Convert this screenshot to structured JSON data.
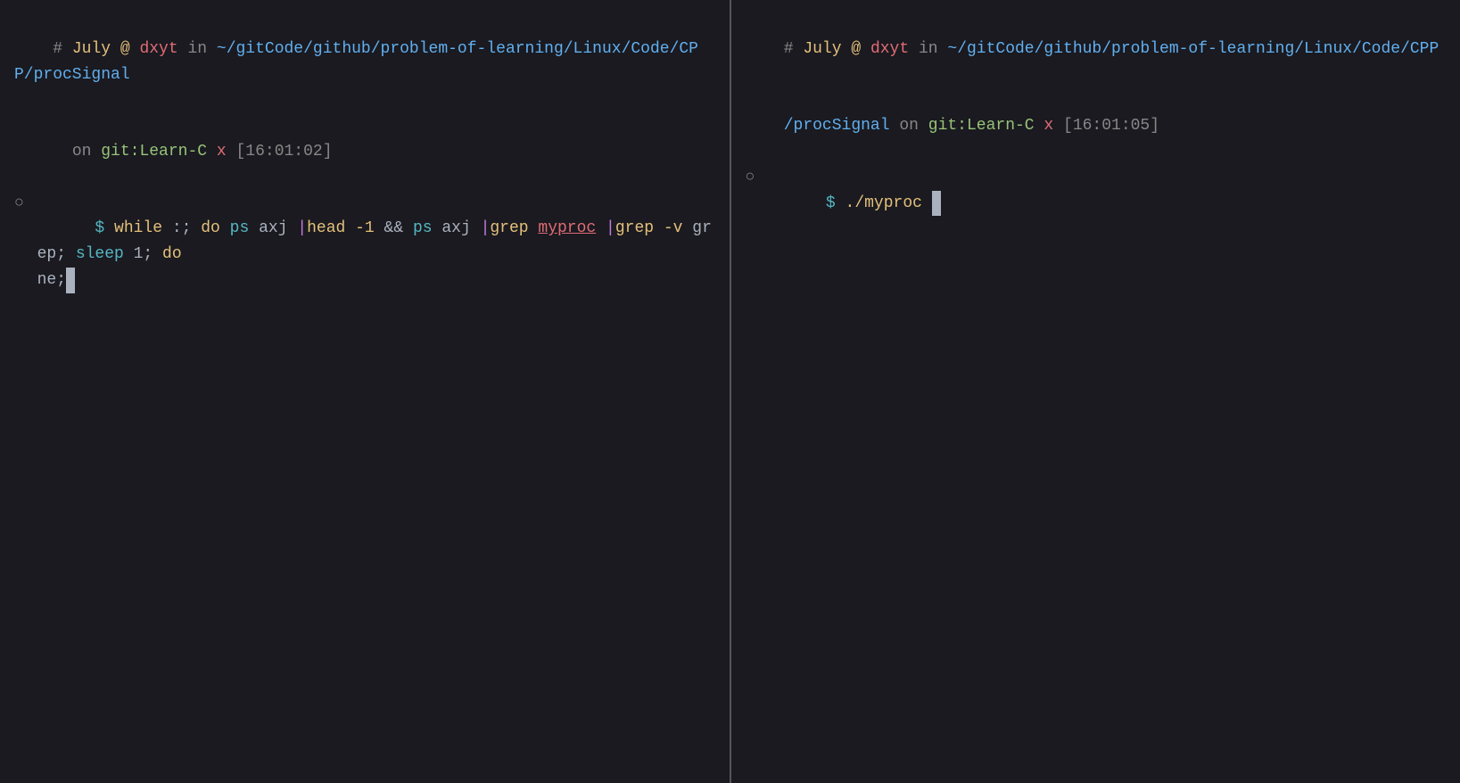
{
  "left_pane": {
    "header_comment": "# ",
    "month": "July",
    "header_rest": " @ ",
    "user": "dxyt",
    "in_text": " in ",
    "path": "~/gitCode/github/problem-of-learning/Linux/Code/CPP/procSignal",
    "newline_on": "  on ",
    "git_label": "git:",
    "branch": "Learn-C",
    "space_x": " x ",
    "time": "[16:01:02]",
    "command_line": "$ while :; do ps axj |head -1 && ps axj |grep myproc |grep -v grep; sleep 1; done;"
  },
  "right_pane": {
    "header_comment": "# ",
    "month": "July",
    "header_rest": " @ ",
    "user": "dxyt",
    "in_text": " in ",
    "path": "~/gitCode/github/problem-of-learning/Linux/Code/CPP/procSignal",
    "newline_on": "  on ",
    "git_label": "git:",
    "branch": "Learn-C",
    "space_x": " x ",
    "time": "[16:01:05]",
    "command": "./myproc"
  }
}
